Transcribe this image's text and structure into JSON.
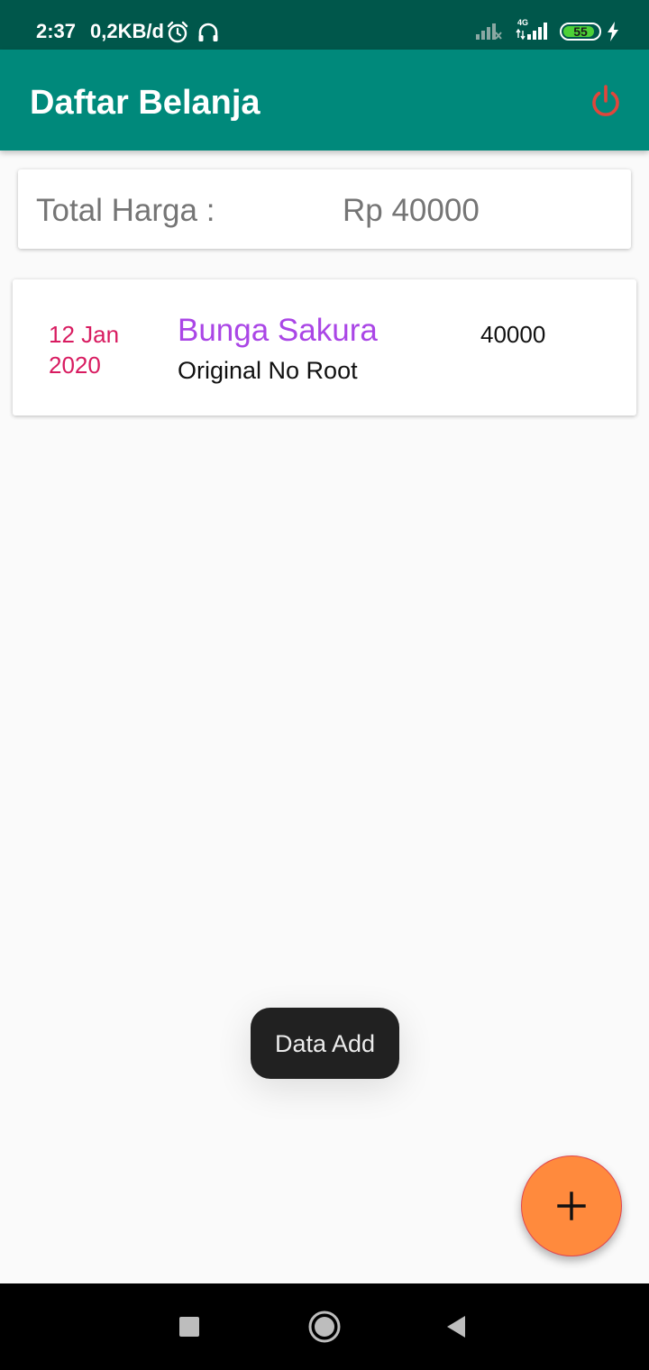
{
  "status_bar": {
    "time": "2:37",
    "net_speed": "0,2KB/d",
    "network_type": "4G",
    "battery_level": "55",
    "icons": [
      "alarm-icon",
      "headset-icon",
      "signal-icon",
      "battery-icon",
      "charging-icon"
    ]
  },
  "app_bar": {
    "title": "Daftar Belanja",
    "action_icon": "power-icon",
    "color": "#00897b"
  },
  "summary": {
    "label": "Total Harga :",
    "value": "Rp 40000"
  },
  "items": [
    {
      "date_day_month": "12 Jan",
      "date_year": "2020",
      "name": "Bunga Sakura",
      "description": "Original No Root",
      "price": "40000"
    }
  ],
  "toast": {
    "message": "Data Add"
  },
  "fab": {
    "icon": "plus-icon",
    "color": "#ff8a3d"
  },
  "nav_bar": {
    "icons": [
      "recents-icon",
      "home-icon",
      "back-icon"
    ]
  },
  "colors": {
    "status_bar": "#00574b",
    "accent_date": "#d81b60",
    "item_title": "#aa46e6",
    "power_icon": "#e0463c"
  }
}
